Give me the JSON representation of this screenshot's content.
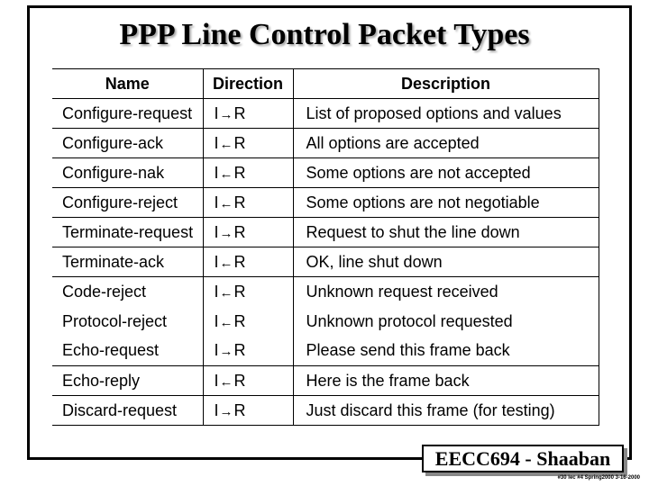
{
  "slide": {
    "title": "PPP Line Control Packet Types",
    "footer_label": "EECC694 - Shaaban",
    "footer_note": "#30 lec #4 Spring2000 3-16-2000"
  },
  "table": {
    "headers": [
      "Name",
      "Direction",
      "Description"
    ],
    "rows": [
      {
        "name": "Configure-request",
        "from": "I",
        "arrow": "→",
        "to": "R",
        "description": "List of proposed options and values",
        "line_above": true
      },
      {
        "name": "Configure-ack",
        "from": "I",
        "arrow": "←",
        "to": "R",
        "description": "All options are accepted",
        "line_above": true
      },
      {
        "name": "Configure-nak",
        "from": "I",
        "arrow": "←",
        "to": "R",
        "description": "Some options are not accepted",
        "line_above": true
      },
      {
        "name": "Configure-reject",
        "from": "I",
        "arrow": "←",
        "to": "R",
        "description": "Some options are not negotiable",
        "line_above": true
      },
      {
        "name": "Terminate-request",
        "from": "I",
        "arrow": "→",
        "to": "R",
        "description": "Request to shut the line down",
        "line_above": true
      },
      {
        "name": "Terminate-ack",
        "from": "I",
        "arrow": "←",
        "to": "R",
        "description": "OK, line shut down",
        "line_above": true
      },
      {
        "name": "Code-reject",
        "from": "I",
        "arrow": "←",
        "to": "R",
        "description": "Unknown request received",
        "line_above": true
      },
      {
        "name": "Protocol-reject",
        "from": "I",
        "arrow": "←",
        "to": "R",
        "description": "Unknown protocol requested",
        "line_above": false
      },
      {
        "name": "Echo-request",
        "from": "I",
        "arrow": "→",
        "to": "R",
        "description": "Please send this frame back",
        "line_above": false
      },
      {
        "name": "Echo-reply",
        "from": "I",
        "arrow": "←",
        "to": "R",
        "description": "Here is the frame back",
        "line_above": true
      },
      {
        "name": "Discard-request",
        "from": "I",
        "arrow": "→",
        "to": "R",
        "description": "Just discard this frame (for testing)",
        "line_above": true
      }
    ]
  }
}
